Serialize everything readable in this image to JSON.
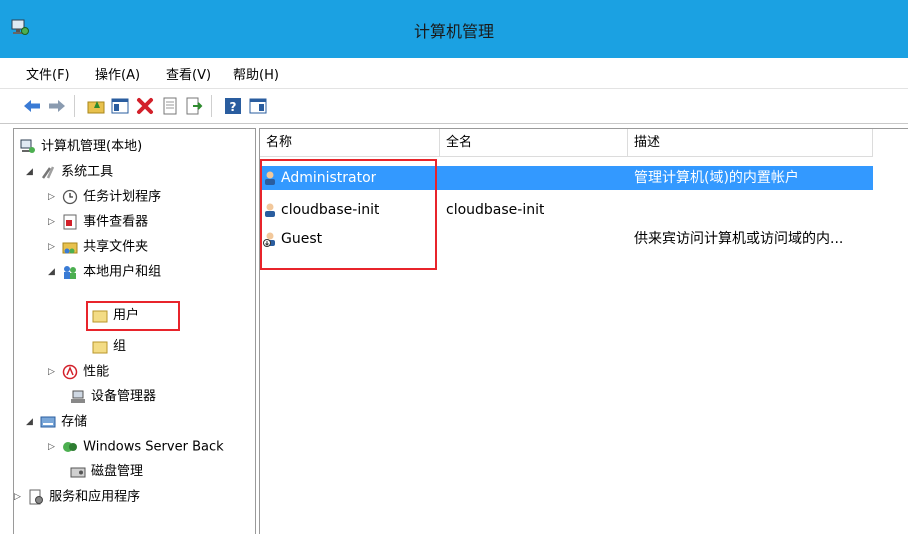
{
  "window": {
    "title": "计算机管理"
  },
  "menu": {
    "file": "文件(F)",
    "action": "操作(A)",
    "view": "查看(V)",
    "help": "帮助(H)"
  },
  "toolbar": {
    "icons": [
      "back-arrow-icon",
      "forward-arrow-icon",
      "up-folder-icon",
      "show-hide-tree-icon",
      "delete-icon",
      "properties-icon",
      "export-list-icon",
      "help-icon",
      "show-hide-action-pane-icon"
    ]
  },
  "tree": {
    "root": "计算机管理(本地)",
    "system_tools": "系统工具",
    "task_scheduler": "任务计划程序",
    "event_viewer": "事件查看器",
    "shared_folders": "共享文件夹",
    "local_users_groups": "本地用户和组",
    "users": "用户",
    "groups": "组",
    "performance": "性能",
    "device_manager": "设备管理器",
    "storage": "存储",
    "windows_server_backup": "Windows Server Back",
    "disk_management": "磁盘管理",
    "services_apps": "服务和应用程序"
  },
  "list": {
    "columns": [
      "名称",
      "全名",
      "描述"
    ],
    "rows": [
      {
        "name": "Administrator",
        "full_name": "",
        "description": "管理计算机(域)的内置帐户"
      },
      {
        "name": "cloudbase-init",
        "full_name": "cloudbase-init",
        "description": ""
      },
      {
        "name": "Guest",
        "full_name": "",
        "description": "供来宾访问计算机或访问域的内..."
      }
    ]
  },
  "colors": {
    "titlebar": "#1ba1e2",
    "selection": "#3399ff",
    "highlight_box": "#e8242b"
  }
}
